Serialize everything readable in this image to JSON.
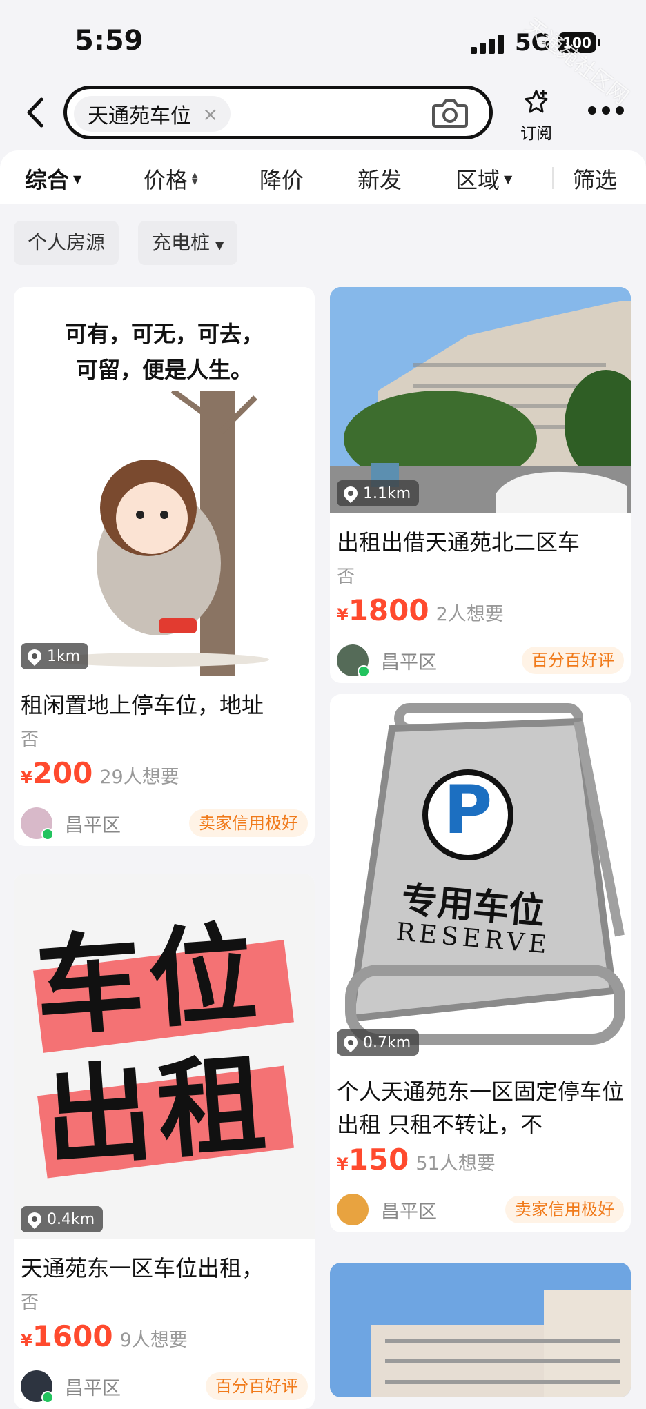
{
  "status_bar": {
    "time": "5:59",
    "network": "5G",
    "battery": "100"
  },
  "watermark": "天通苑社区网",
  "search": {
    "query_chip": "天通苑车位",
    "chip_clear": "×",
    "subscribe_label": "订阅"
  },
  "filters": [
    "综合",
    "价格",
    "降价",
    "新发",
    "区域",
    "筛选"
  ],
  "tags": [
    "个人房源",
    "充电桩"
  ],
  "listings": [
    {
      "distance": "1km",
      "image_text_line1": "可有，可无，可去，",
      "image_text_line2": "可留，便是人生。",
      "title": "租闲置地上停车位，地址",
      "sub": "否",
      "yen": "¥",
      "price": "200",
      "want": "29人想要",
      "area": "昌平区",
      "badge": "卖家信用极好"
    },
    {
      "distance": "1.1km",
      "title": "出租出借天通苑北二区车",
      "sub": "否",
      "yen": "¥",
      "price": "1800",
      "want": "2人想要",
      "area": "昌平区",
      "badge": "百分百好评"
    },
    {
      "distance": "0.7km",
      "image_text_cn": "专用车位",
      "image_text_en": "RESERVE",
      "image_sign": "P",
      "title": "个人天通苑东一区固定停车位出租 只租不转让，不",
      "yen": "¥",
      "price": "150",
      "want": "51人想要",
      "area": "昌平区",
      "badge": "卖家信用极好"
    },
    {
      "distance": "0.4km",
      "image_text_line1": "车位",
      "image_text_line2": "出租",
      "title": "天通苑东一区车位出租，",
      "sub": "否",
      "yen": "¥",
      "price": "1600",
      "want": "9人想要",
      "area": "昌平区",
      "badge": "百分百好评"
    }
  ],
  "colors": {
    "price": "#ff4a2e",
    "badge_text": "#f07a1a",
    "badge_bg": "#fff3e6",
    "page_bg": "#f4f4f7"
  }
}
